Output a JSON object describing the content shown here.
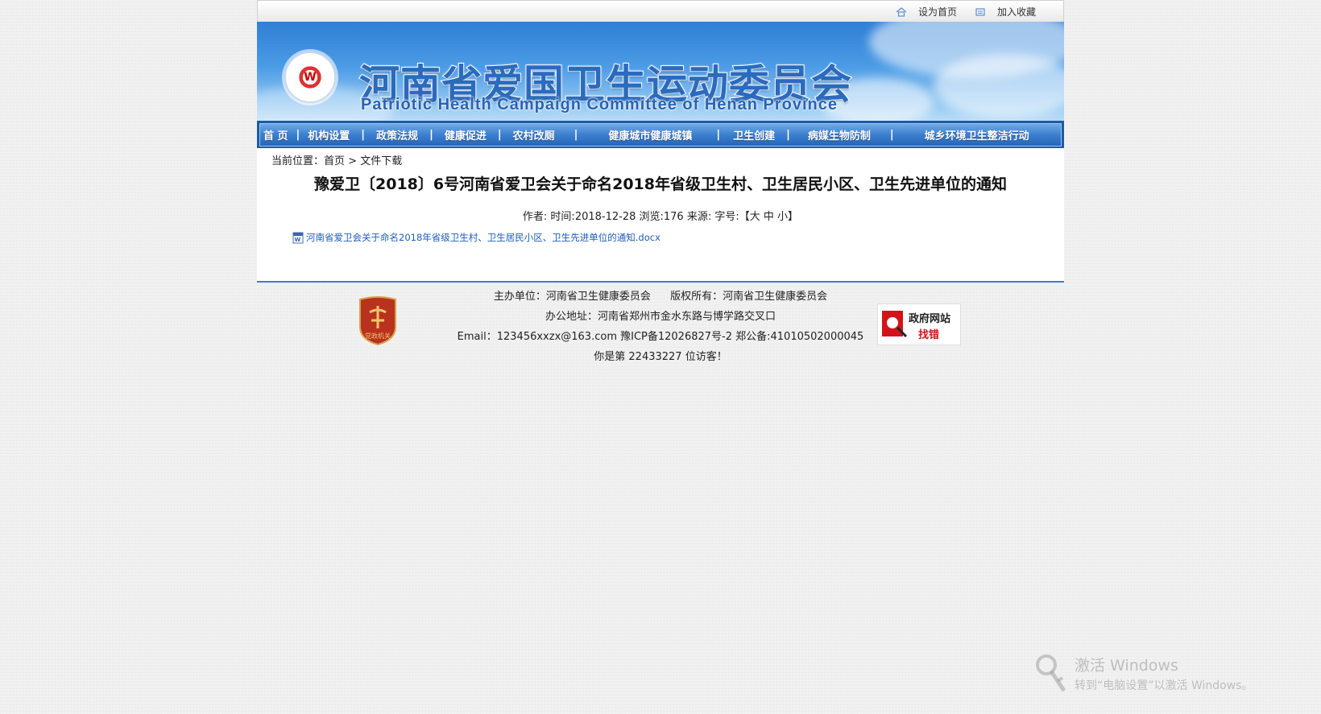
{
  "topbar": {
    "set_home": "设为首页",
    "add_fav": "加入收藏",
    "home_icon": "house-icon",
    "fav_icon": "bookmark-icon"
  },
  "banner": {
    "title_cn": "河南省爱国卫生运动委员会",
    "title_en": "Patriotic Health Campaign Committee of Henan Province",
    "logo_letter": "W"
  },
  "nav": {
    "items": [
      "首 页",
      "机构设置",
      "政策法规",
      "健康促进",
      "农村改厕",
      "健康城市健康城镇",
      "卫生创建",
      "病媒生物防制",
      "城乡环境卫生整洁行动"
    ]
  },
  "breadcrumb": {
    "prefix": "当前位置：",
    "home": "首页",
    "sep": ">",
    "current": "文件下载"
  },
  "article": {
    "title": "豫爱卫〔2018〕6号河南省爱卫会关于命名2018年省级卫生村、卫生居民小区、卫生先进单位的通知",
    "meta_prefix": "作者: 时间:2018-12-28 浏览:176 来源: 字号:【",
    "size_large": "大",
    "size_medium": "中",
    "size_small": "小",
    "meta_suffix": "】",
    "attachment": "河南省爱卫会关于命名2018年省级卫生村、卫生居民小区、卫生先进单位的通知.docx"
  },
  "footer": {
    "host": "主办单位：河南省卫生健康委员会",
    "copyright": "版权所有：河南省卫生健康委员会",
    "address": "办公地址：河南省郑州市金水东路与博学路交叉口",
    "contact": "Email：123456xxzx@163.com 豫ICP备12026827号-2 郑公备:41010502000045",
    "visitors": "你是第 22433227 位访客！",
    "party_badge_text": "党政机关",
    "error_title": "政府网站",
    "error_sub": "找错"
  },
  "watermark": {
    "line1": "激活 Windows",
    "line2": "转到“电脑设置”以激活 Windows。"
  },
  "colors": {
    "nav_blue": "#2766b7",
    "link_blue": "#1e5eb8",
    "error_red": "#d2141a"
  }
}
